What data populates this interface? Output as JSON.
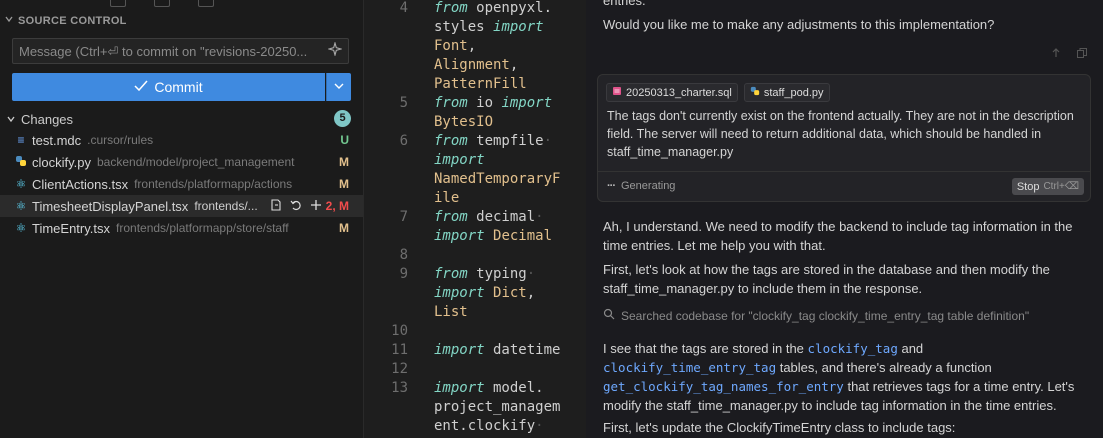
{
  "source_control": {
    "title": "SOURCE CONTROL",
    "message_placeholder": "Message (Ctrl+⏎ to commit on \"revisions-20250...",
    "commit_label": "Commit",
    "changes_label": "Changes",
    "changes_count": "5",
    "files": [
      {
        "name": "test.mdc",
        "path": ".cursor/rules",
        "status": "U",
        "icon": "info-icon"
      },
      {
        "name": "clockify.py",
        "path": "backend/model/project_management",
        "status": "M",
        "icon": "python-icon"
      },
      {
        "name": "ClientActions.tsx",
        "path": "frontends/platformapp/actions",
        "status": "M",
        "icon": "react-icon"
      },
      {
        "name": "TimesheetDisplayPanel.tsx",
        "path": "frontends/...",
        "status": "2, M",
        "icon": "react-icon"
      },
      {
        "name": "TimeEntry.tsx",
        "path": "frontends/platformapp/store/staff",
        "status": "M",
        "icon": "react-icon"
      }
    ]
  },
  "editor": {
    "line_numbers": [
      "4",
      "5",
      "6",
      "7",
      "8",
      "9",
      "10",
      "11",
      "12",
      "13"
    ]
  },
  "chat": {
    "prev_tail": "entries.",
    "prev_question": "Would you like me to make any adjustments to this implementation?",
    "attachments": [
      "20250313_charter.sql",
      "staff_pod.py"
    ],
    "user_message": "The tags don't currently exist on the frontend actually. They are not in the description field. The server will need to return additional data, which should be handled in staff_time_manager.py",
    "status": "Generating",
    "stop_label": "Stop",
    "stop_shortcut": "Ctrl+⌫",
    "reply1": "Ah, I understand. We need to modify the backend to include tag information in the time entries. Let me help you with that.",
    "reply2": "First, let's look at how the tags are stored in the database and then modify the staff_time_manager.py to include them in the response.",
    "search_text": "Searched codebase for \"clockify_tag clockify_time_entry_tag table definition\"",
    "reply3_a": "I see that the tags are stored in the",
    "reply3_code1": "clockify_tag",
    "reply3_and": "and",
    "reply3_code2": "clockify_time_entry_tag",
    "reply3_b": "tables, and there's already a function",
    "reply3_code3": "get_clockify_tag_names_for_entry",
    "reply3_c": "that retrieves tags for a time entry. Let's modify the staff_time_manager.py to include tag information in the time entries.",
    "reply4": "First, let's update the ClockifyTimeEntry class to include tags:"
  },
  "colors": {
    "accent": "#3f8ae0",
    "status_untracked": "#73c991",
    "status_modified": "#e2c08d",
    "status_error": "#f14c4c",
    "keyword": "#83d6c5",
    "type": "#e2c08d",
    "inline_code": "#6ea8fe"
  }
}
